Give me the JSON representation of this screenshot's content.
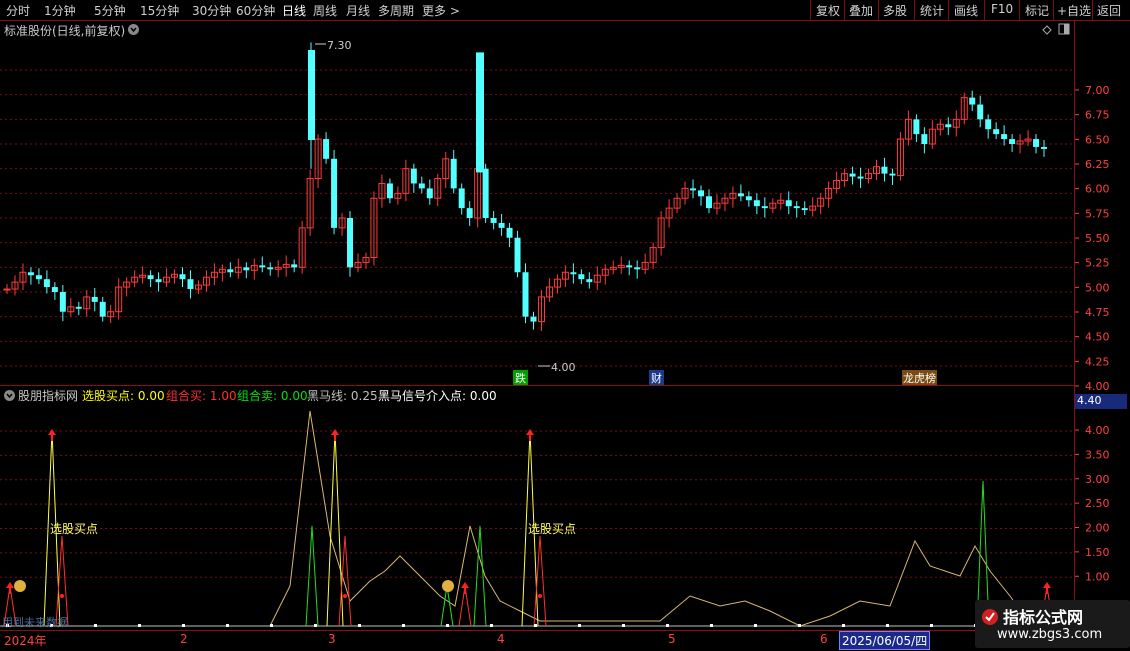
{
  "toolbar": {
    "periods": [
      "分时",
      "1分钟",
      "5分钟",
      "15分钟",
      "30分钟",
      "60分钟",
      "日线",
      "周线",
      "月线",
      "多周期",
      "更多 >"
    ],
    "active_period": "日线",
    "actions": [
      "复权",
      "叠加",
      "多股",
      "统计",
      "画线",
      "F10",
      "标记",
      "+自选",
      "返回"
    ]
  },
  "main_panel": {
    "title": "标准股份(日线,前复权)",
    "max_label": "7.30",
    "min_label": "4.00",
    "event_tags": [
      "跌",
      "财",
      "龙虎榜"
    ],
    "y_ticks": [
      "7.00",
      "6.75",
      "6.50",
      "6.25",
      "6.00",
      "5.75",
      "5.50",
      "5.25",
      "5.00",
      "4.75",
      "4.50",
      "4.25",
      "4.00"
    ]
  },
  "indicator_panel": {
    "name": "股朋指标网",
    "legend": [
      {
        "label": "选股买点:",
        "value": "0.00",
        "color": "#ffff00"
      },
      {
        "label": "组合买:",
        "value": "1.00",
        "color": "#ff3030"
      },
      {
        "label": "组合卖:",
        "value": "0.00",
        "color": "#00e000"
      },
      {
        "label": "黑马线:",
        "value": "0.25",
        "color": "#c0c0c0"
      },
      {
        "label": "黑马信号介入点:",
        "value": "0.00",
        "color": "#ffffff"
      }
    ],
    "annotation": "选股买点",
    "y_ticks": [
      "4.00",
      "3.50",
      "3.00",
      "2.50",
      "2.00",
      "1.50",
      "1.00"
    ],
    "cursor_value": "4.40",
    "overlay_note": "用到未来数据"
  },
  "time_axis": {
    "labels": [
      "2024年",
      "2",
      "3",
      "4",
      "5",
      "6"
    ],
    "cursor_date": "2025/06/05/四"
  },
  "watermark": {
    "title": "指标公式网",
    "url": "www.zbgs3.com"
  },
  "colors": {
    "up": "#ff3b3b",
    "down": "#54ffff",
    "grid": "#7a0f0f",
    "axis_text": "#ff4040"
  }
}
